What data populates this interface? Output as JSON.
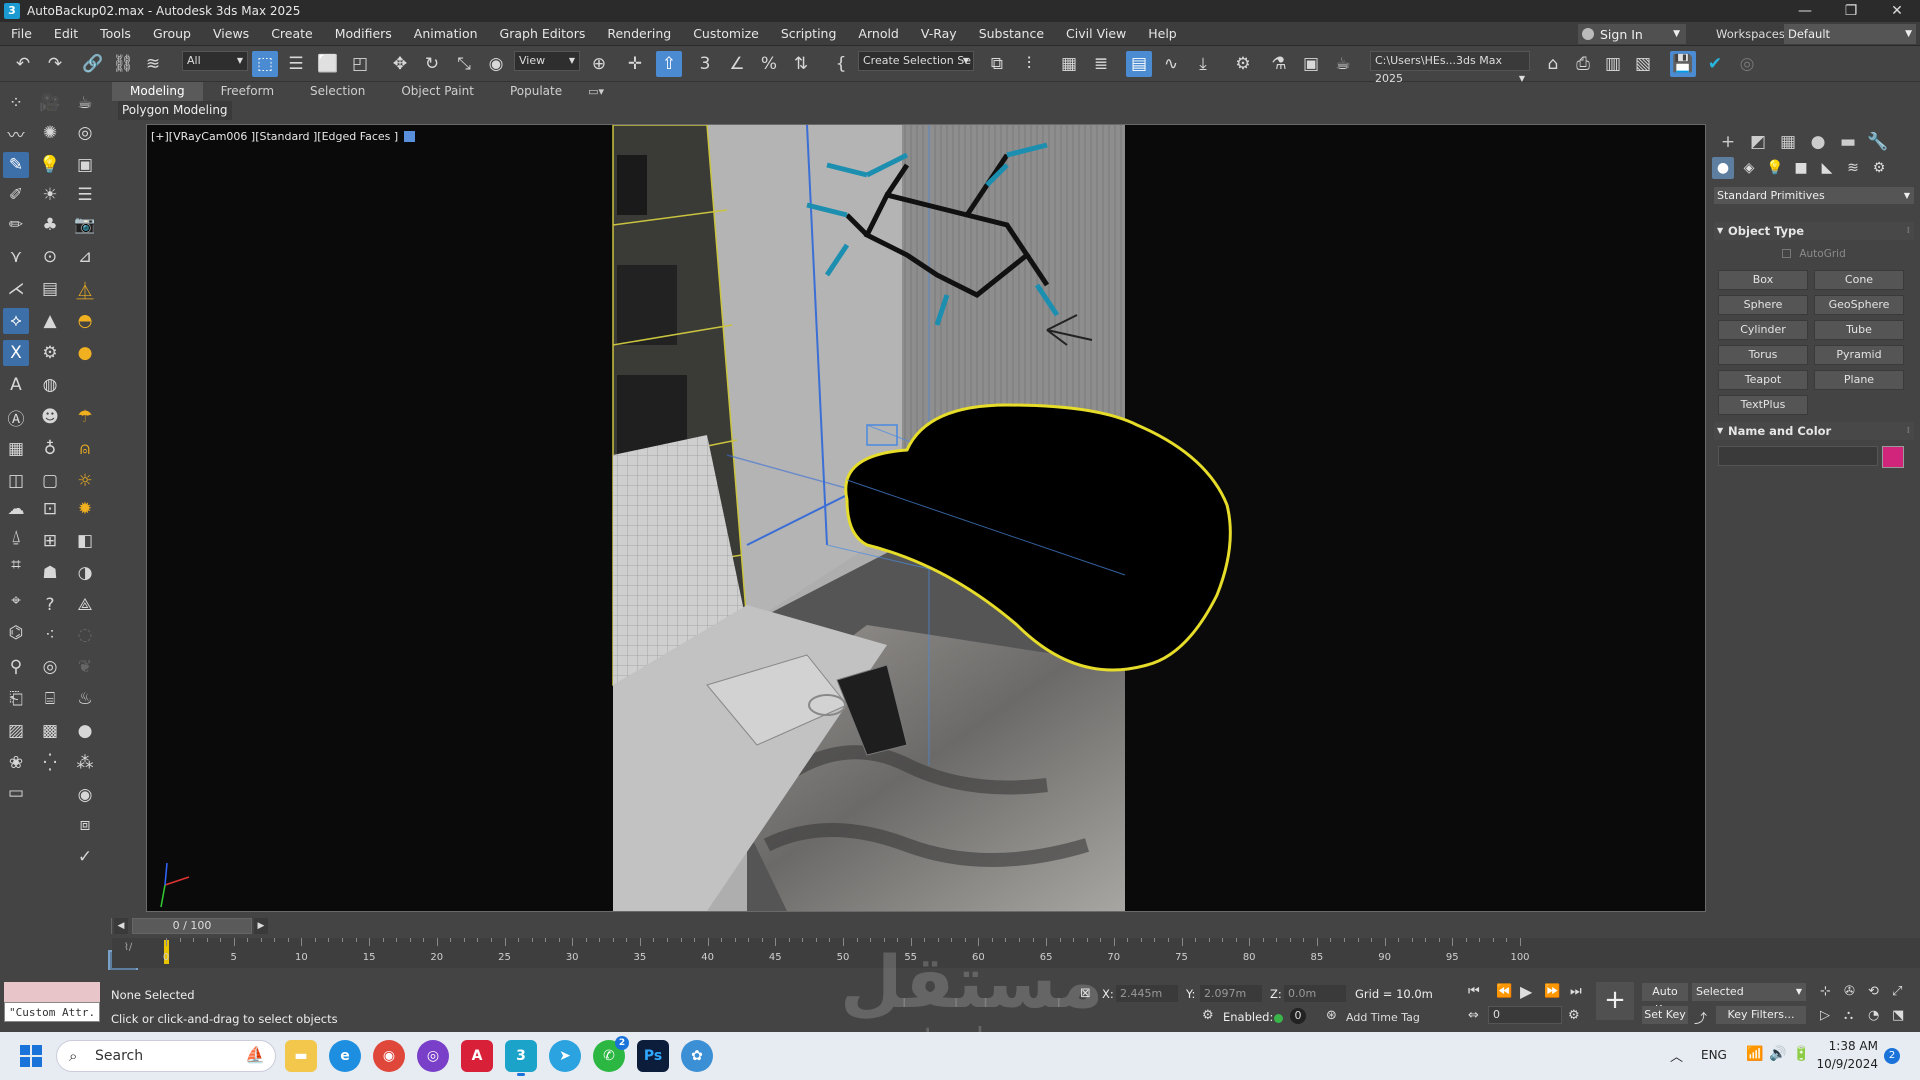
{
  "window": {
    "title": "AutoBackup02.max - Autodesk 3ds Max 2025",
    "app_icon": "3"
  },
  "menu": [
    "File",
    "Edit",
    "Tools",
    "Group",
    "Views",
    "Create",
    "Modifiers",
    "Animation",
    "Graph Editors",
    "Rendering",
    "Customize",
    "Scripting",
    "Arnold",
    "V-Ray",
    "Substance",
    "Civil View",
    "Help"
  ],
  "account": {
    "sign_in": "Sign In",
    "workspaces_label": "Workspaces:",
    "workspace": "Default"
  },
  "toolbar": {
    "selection_filter": "All",
    "ref_coord": "View",
    "selection_set": "Create Selection Se",
    "project_path": "C:\\Users\\HEs...3ds Max 2025"
  },
  "ribbon": {
    "tabs": [
      "Modeling",
      "Freeform",
      "Selection",
      "Object Paint",
      "Populate"
    ],
    "active_tab": "Modeling",
    "sub_label": "Polygon Modeling"
  },
  "viewport": {
    "label": "[+][VRayCam006 ][Standard ][Edged Faces ]"
  },
  "command_panel": {
    "category": "Standard Primitives",
    "object_type_title": "Object Type",
    "autogrid": "AutoGrid",
    "buttons": [
      "Box",
      "Cone",
      "Sphere",
      "GeoSphere",
      "Cylinder",
      "Tube",
      "Torus",
      "Pyramid",
      "Teapot",
      "Plane",
      "TextPlus"
    ],
    "name_color_title": "Name and Color",
    "object_color": "#d0257a"
  },
  "timeline": {
    "frame_display": "0 / 100",
    "ticks": [
      "0",
      "5",
      "10",
      "15",
      "20",
      "25",
      "30",
      "35",
      "40",
      "45",
      "50",
      "55",
      "60",
      "65",
      "70",
      "75",
      "80",
      "85",
      "90",
      "95",
      "100"
    ]
  },
  "status": {
    "custom_attr": "\"Custom Attr.",
    "selection": "None Selected",
    "prompt": "Click or click-and-drag to select objects",
    "x_label": "X:",
    "x_value": "2.445m",
    "y_label": "Y:",
    "y_value": "2.097m",
    "z_label": "Z:",
    "z_value": "0.0m",
    "grid": "Grid = 10.0m",
    "enabled_label": "Enabled:",
    "enabled_count": "0",
    "add_time_tag": "Add Time Tag",
    "frame_value": "0",
    "auto_key": "Auto Key",
    "set_key": "Set Key",
    "key_mode": "Selected",
    "key_filters": "Key Filters..."
  },
  "taskbar": {
    "search_placeholder": "Search",
    "apps": [
      "File Explorer",
      "Edge",
      "Chrome",
      "Podcast",
      "Autodesk",
      "3ds Max",
      "Telegram",
      "WhatsApp",
      "Photoshop",
      "Globe"
    ],
    "whatsapp_badge": "2",
    "lang": "ENG",
    "time": "1:38 AM",
    "date": "10/9/2024",
    "notifications": "2"
  },
  "watermark": {
    "arabic": "مستقل",
    "latin": "mostaql.com"
  }
}
